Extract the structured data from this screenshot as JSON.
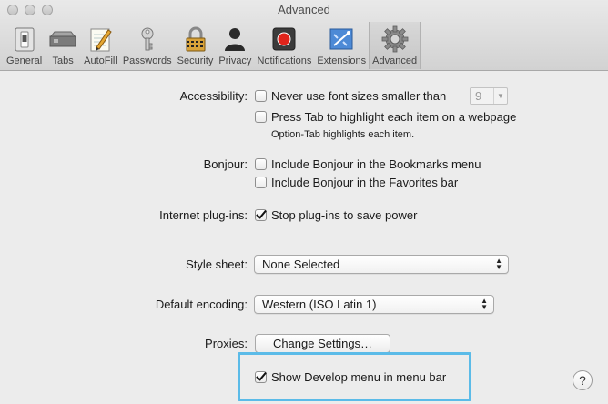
{
  "window": {
    "title": "Advanced"
  },
  "toolbar": {
    "tabs": [
      {
        "label": "General",
        "icon": "general-switch-icon"
      },
      {
        "label": "Tabs",
        "icon": "tabs-icon"
      },
      {
        "label": "AutoFill",
        "icon": "autofill-pencil-icon"
      },
      {
        "label": "Passwords",
        "icon": "key-icon"
      },
      {
        "label": "Security",
        "icon": "lock-icon"
      },
      {
        "label": "Privacy",
        "icon": "person-silhouette-icon"
      },
      {
        "label": "Notifications",
        "icon": "notification-icon"
      },
      {
        "label": "Extensions",
        "icon": "puzzle-icon"
      },
      {
        "label": "Advanced",
        "icon": "gear-icon"
      }
    ],
    "active_tab": "Advanced"
  },
  "accessibility": {
    "label": "Accessibility:",
    "font_size_option": "Never use font sizes smaller than",
    "font_size_value": "9",
    "tab_option": "Press Tab to highlight each item on a webpage",
    "tab_note": "Option-Tab highlights each item."
  },
  "bonjour": {
    "label": "Bonjour:",
    "bookmarks_option": "Include Bonjour in the Bookmarks menu",
    "favorites_option": "Include Bonjour in the Favorites bar"
  },
  "plugins": {
    "label": "Internet plug-ins:",
    "stop_option": "Stop plug-ins to save power"
  },
  "stylesheet": {
    "label": "Style sheet:",
    "value": "None Selected"
  },
  "encoding": {
    "label": "Default encoding:",
    "value": "Western (ISO Latin 1)"
  },
  "proxies": {
    "label": "Proxies:",
    "button": "Change Settings…"
  },
  "develop": {
    "option": "Show Develop menu in menu bar"
  },
  "help": {
    "label": "?"
  },
  "colors": {
    "highlight": "#5bbbe8",
    "window_bg": "#ececec"
  }
}
